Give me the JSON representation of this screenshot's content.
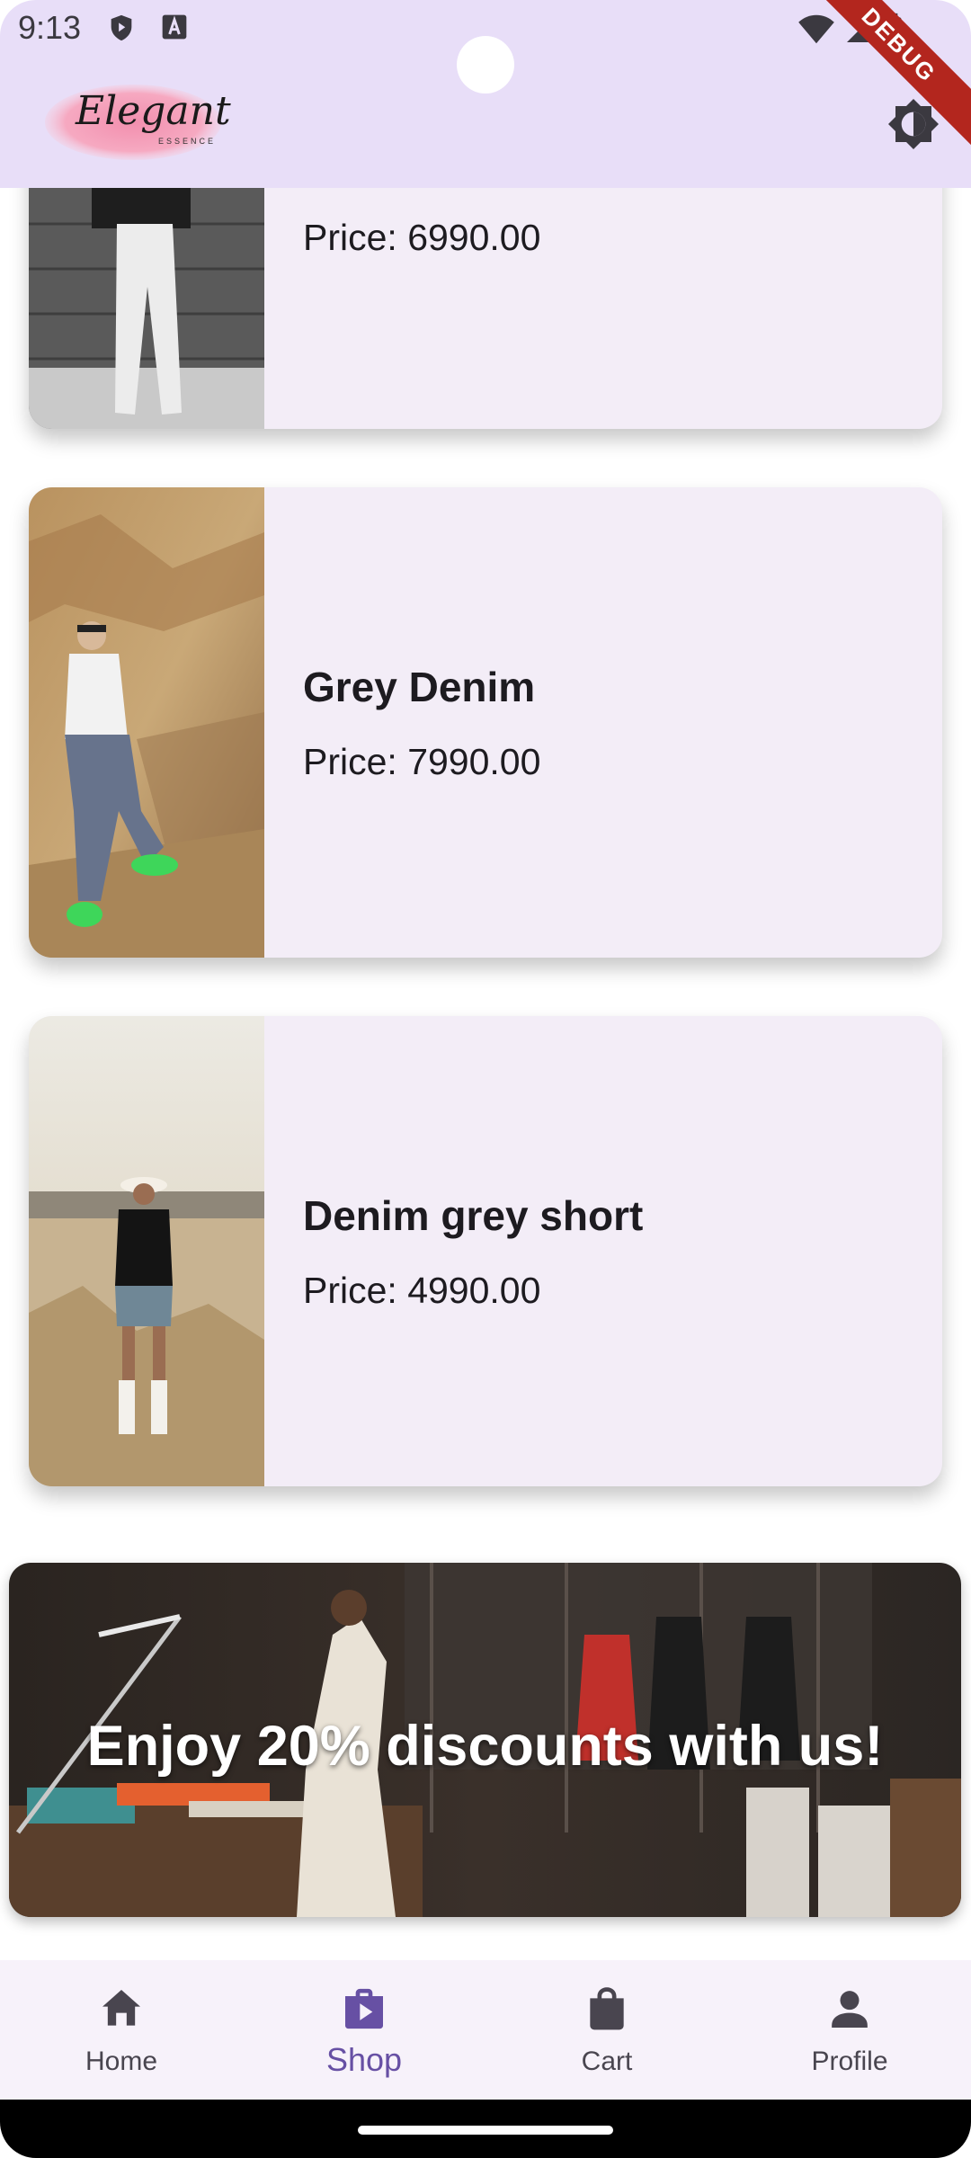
{
  "status_bar": {
    "time": "9:13"
  },
  "app_bar": {
    "logo_title": "Elegant",
    "logo_subtitle": "ESSENCE",
    "debug_banner": "DEBUG"
  },
  "products": [
    {
      "name": "",
      "price": "Price: 6990.00"
    },
    {
      "name": "Grey Denim",
      "price": "Price: 7990.00"
    },
    {
      "name": "Denim grey short",
      "price": "Price: 4990.00"
    }
  ],
  "promo_banner": {
    "text": "Enjoy 20% discounts with us!"
  },
  "bottom_nav": {
    "items": [
      {
        "label": "Home",
        "icon": "home-icon"
      },
      {
        "label": "Shop",
        "icon": "shop-icon"
      },
      {
        "label": "Cart",
        "icon": "cart-icon"
      },
      {
        "label": "Profile",
        "icon": "profile-icon"
      }
    ],
    "active": "Shop"
  },
  "colors": {
    "accent": "#6750a4",
    "card": "#f3edf7",
    "app_bar": "#e8def8"
  }
}
